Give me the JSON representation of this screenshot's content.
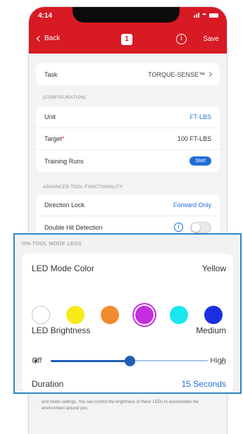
{
  "status": {
    "time": "4:14"
  },
  "nav": {
    "back": "Back",
    "badge": "1",
    "info": "i",
    "save": "Save"
  },
  "task": {
    "label": "Task",
    "value": "TORQUE-SENSE™"
  },
  "config": {
    "section": "[CONFIGURATION]",
    "unit_label": "Unit",
    "unit_value": "FT-LBS",
    "target_label": "Target",
    "target_required": "*",
    "target_value": "100 FT-LBS",
    "training_label": "Training Runs",
    "training_button": "Start"
  },
  "advanced": {
    "section": "ADVANCED TOOL FUNCTIONALITY",
    "direction_label": "Direction Lock",
    "direction_value": "Forward Only",
    "double_hit_label": "Double Hit Detection",
    "double_hit_on": false
  },
  "description": "and mode settings. You can control the brightness of these LEDs to accomodate the environment around you.",
  "leds": {
    "section": "ON-TOOL MODE LEDS",
    "mode_color_label": "LED Mode Color",
    "mode_color_value": "Yellow",
    "swatches": [
      "#ffffff",
      "#f6ea1a",
      "#f28a2e",
      "#c62ee0",
      "#19e8ee",
      "#1c2fe0"
    ],
    "selected_swatch_index": 3,
    "brightness_label": "LED Brightness",
    "brightness_value": "Medium",
    "brightness_level": 0.5,
    "min_label": "Off",
    "max_label": "High",
    "duration_label": "Duration",
    "duration_value": "15 Seconds"
  },
  "colors": {
    "brand_red": "#d71a24",
    "accent_blue": "#1f6fd6",
    "highlight_blue": "#2f86c9"
  }
}
